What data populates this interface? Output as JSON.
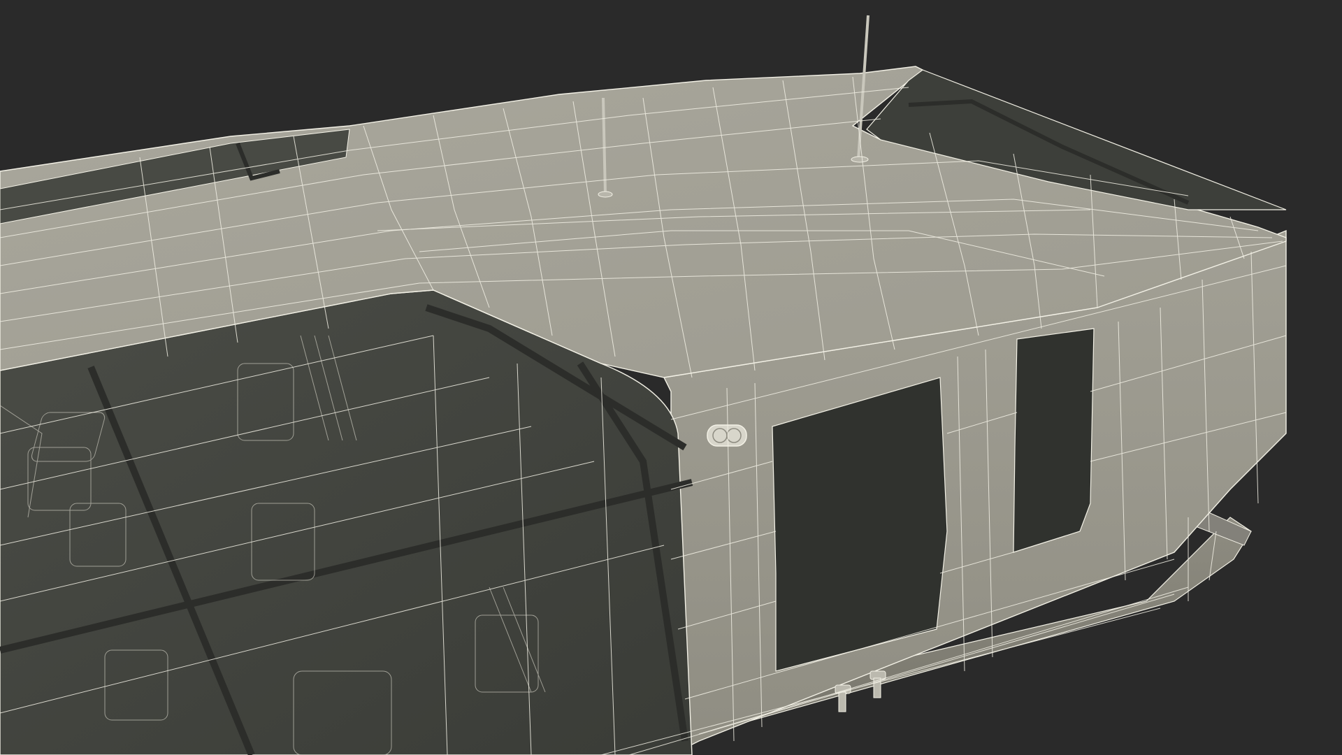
{
  "scene": {
    "subject": "",
    "background_color": "#2a2a2a",
    "body_color": "#9c9a8f",
    "body_shade_color": "#858377",
    "roof_color": "#a4a296",
    "glass_color": "#3d3f3a",
    "glass_dark_color": "#30322e",
    "wire_color": "#f3f1e6",
    "frame_color": "#2c2d2a"
  }
}
